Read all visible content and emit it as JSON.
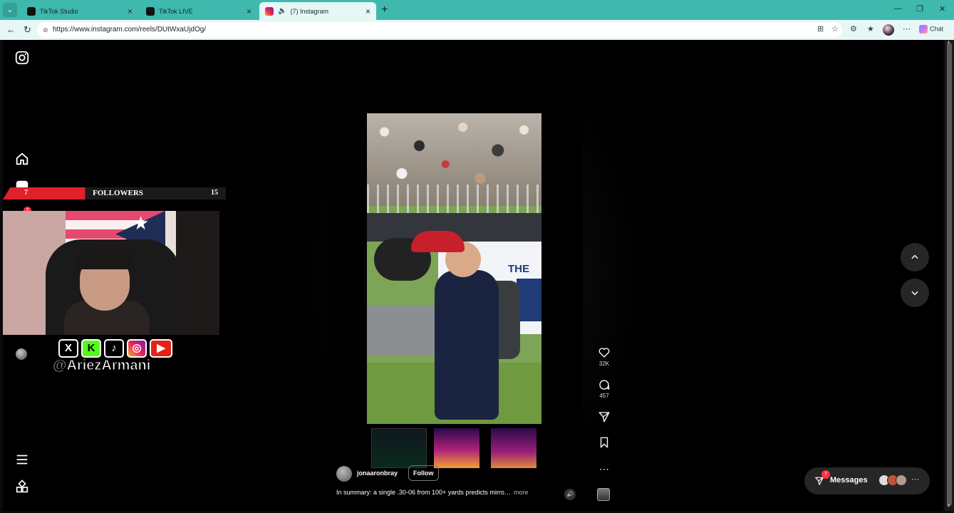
{
  "browser": {
    "tabs": [
      {
        "title": "TikTok Studio",
        "icon": "tiktok-icon"
      },
      {
        "title": "TikTok LIVE",
        "icon": "tiktok-icon"
      },
      {
        "title": "(7) Instagram",
        "icon": "instagram-icon",
        "active": true
      }
    ],
    "url": "https://www.instagram.com/reels/DUtWxaUjdOg/",
    "chat_label": "Chat"
  },
  "reel": {
    "owner": "jonaaronbray",
    "follow_label": "Follow",
    "caption": "In summary: a single .30-06 from 100+ yards predicts mirro…",
    "more_label": "more",
    "video_sign_text": "THE",
    "likes": "32K",
    "comments": "457"
  },
  "messages": {
    "label": "Messages",
    "badge": "7"
  },
  "stream_overlay": {
    "followers_label": "FOLLOWERS",
    "left_count": "7",
    "right_count": "15",
    "handle": "@AriezArmani",
    "social_icons": [
      "x-icon",
      "kick-icon",
      "tiktok-icon",
      "instagram-icon",
      "youtube-icon"
    ],
    "social_glyphs": {
      "x": "X",
      "kick": "K"
    }
  },
  "sidebar": {
    "notification_badge": "7"
  },
  "colors": {
    "browser_chrome": "#3fb8ae",
    "accent_red": "#ff3040",
    "overlay_red": "#e0202a"
  }
}
